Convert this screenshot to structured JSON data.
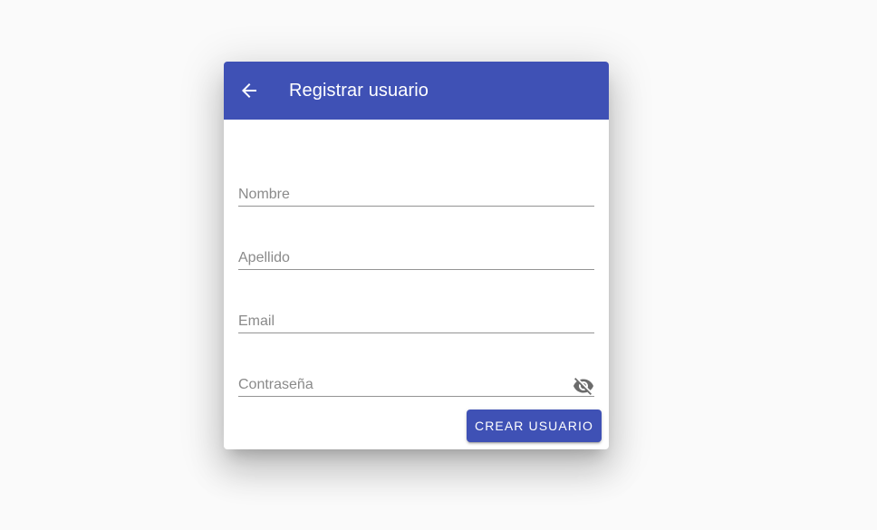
{
  "dialog": {
    "title": "Registrar usuario",
    "back_icon": "arrow-left-icon"
  },
  "form": {
    "fields": [
      {
        "name": "nombre",
        "placeholder": "Nombre",
        "value": ""
      },
      {
        "name": "apellido",
        "placeholder": "Apellido",
        "value": ""
      },
      {
        "name": "email",
        "placeholder": "Email",
        "value": ""
      },
      {
        "name": "password",
        "placeholder": "Contraseña",
        "value": "",
        "toggle_icon": "visibility-off-icon"
      }
    ],
    "submit_label": "CREAR USUARIO"
  },
  "colors": {
    "primary": "#3f51b5",
    "background": "#fafafa",
    "surface": "#ffffff"
  }
}
